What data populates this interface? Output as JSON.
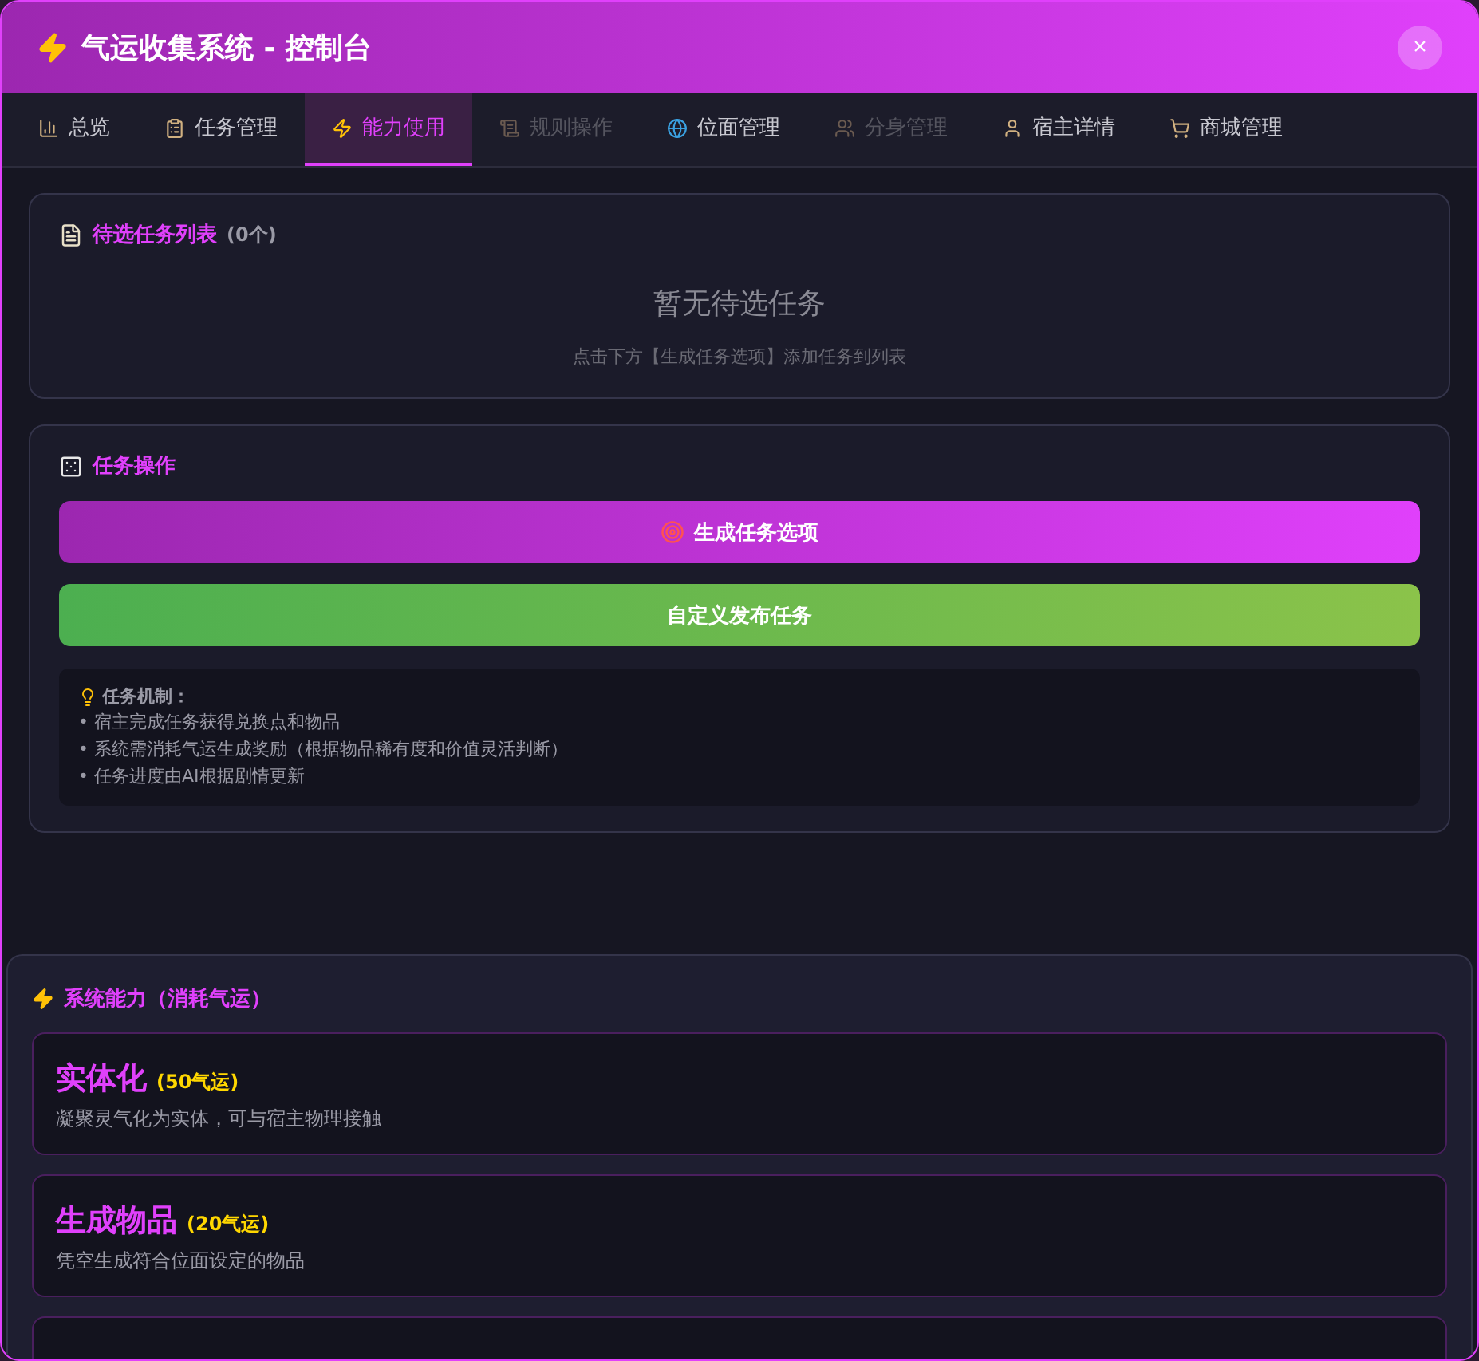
{
  "window": {
    "title": "气运收集系统 - 控制台",
    "close": "×"
  },
  "tabs": [
    {
      "label": "总览",
      "selected": false,
      "disabled": false
    },
    {
      "label": "任务管理",
      "selected": false,
      "disabled": false
    },
    {
      "label": "能力使用",
      "selected": true,
      "disabled": false
    },
    {
      "label": "规则操作",
      "selected": false,
      "disabled": true
    },
    {
      "label": "位面管理",
      "selected": false,
      "disabled": false
    },
    {
      "label": "分身管理",
      "selected": false,
      "disabled": true
    },
    {
      "label": "宿主详情",
      "selected": false,
      "disabled": false
    },
    {
      "label": "商城管理",
      "selected": false,
      "disabled": false
    }
  ],
  "pending_tasks": {
    "title": "待选任务列表",
    "count": "(0个)",
    "empty_title": "暂无待选任务",
    "empty_hint": "点击下方【生成任务选项】添加任务到列表"
  },
  "task_actions": {
    "title": "任务操作",
    "generate_button": "生成任务选项",
    "custom_button": "自定义发布任务",
    "notes_title": "任务机制：",
    "notes": [
      "• 宿主完成任务获得兑换点和物品",
      "• 系统需消耗气运生成奖励（根据物品稀有度和价值灵活判断）",
      "• 任务进度由AI根据剧情更新"
    ]
  },
  "abilities": {
    "title": "系统能力（消耗气运）",
    "items": [
      {
        "name": "实体化",
        "cost": "(50气运)",
        "description": "凝聚灵气化为实体，可与宿主物理接触"
      },
      {
        "name": "生成物品",
        "cost": "(20气运)",
        "description": "凭空生成符合位面设定的物品"
      }
    ],
    "more_cut_off": true
  }
}
